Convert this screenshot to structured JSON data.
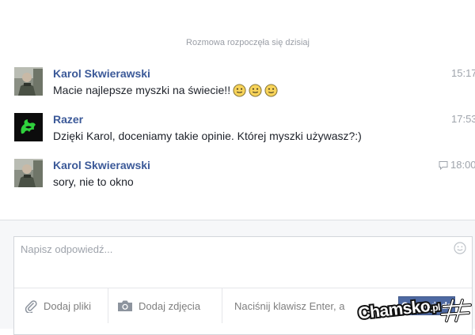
{
  "conversation": {
    "start_label": "Rozmowa rozpoczęła się dzisiaj"
  },
  "messages": [
    {
      "sender": "Karol Skwierawski",
      "text": "Macie najlepsze myszki na świecie!!",
      "time": "15:17",
      "emojis": [
        "smiley-emoji",
        "smiley-emoji",
        "smiley-emoji"
      ],
      "avatar": "karol-avatar"
    },
    {
      "sender": "Razer",
      "text": "Dzięki Karol, doceniamy takie opinie. Której myszki używasz?:)",
      "time": "17:53",
      "avatar": "razer-logo-avatar"
    },
    {
      "sender": "Karol Skwierawski",
      "text": "sory, nie to okno",
      "time": "18:00",
      "time_icon": "chat-bubble-icon",
      "avatar": "karol-avatar"
    }
  ],
  "reply": {
    "placeholder": "Napisz odpowiedź...",
    "add_files_label": "Dodaj pliki",
    "add_photos_label": "Dodaj zdjęcia",
    "enter_hint": "Naciśnij klawisz Enter, a",
    "send_label": "Odpowiedz",
    "icons": {
      "files": "paperclip-icon",
      "photos": "camera-icon",
      "emoji": "smiley-icon"
    }
  },
  "watermark": {
    "text": "Chamsko.pl"
  },
  "colors": {
    "sender": "#3b5998",
    "meta": "#9ea3ab",
    "send_button": "#4e69a2"
  }
}
